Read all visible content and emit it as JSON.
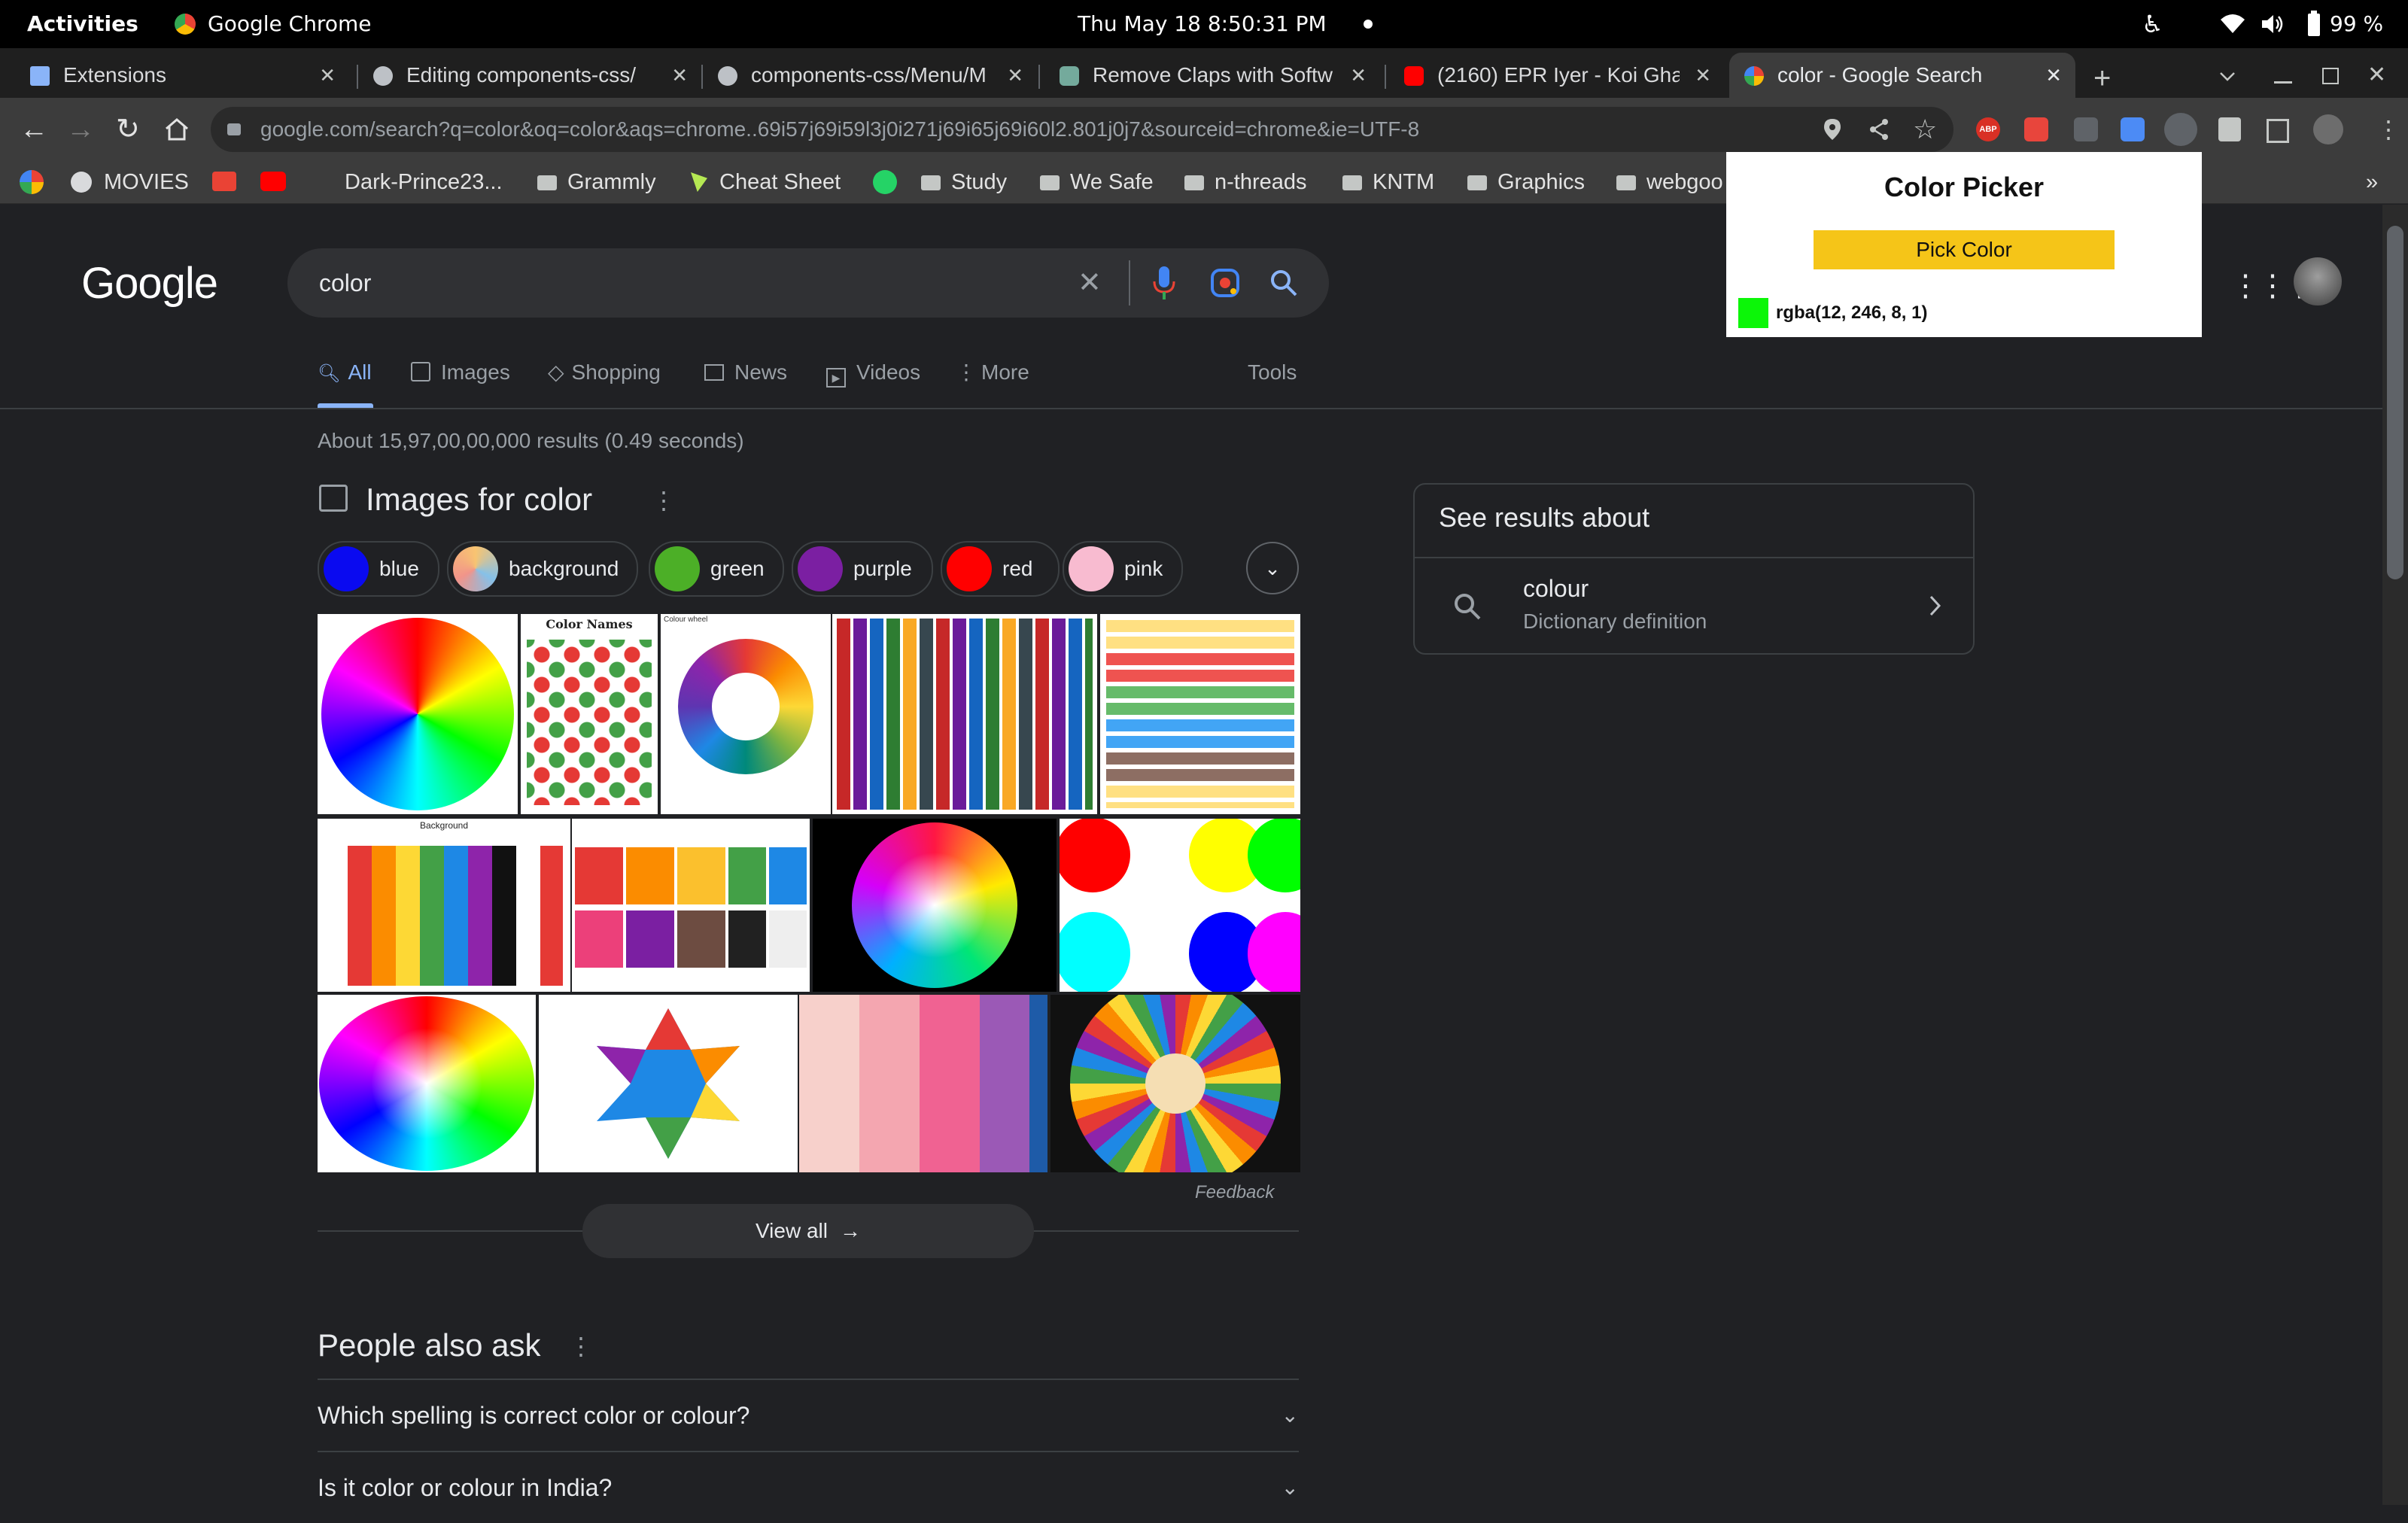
{
  "topbar": {
    "activities": "Activities",
    "app_name": "Google Chrome",
    "datetime": "Thu May 18   8:50:31 PM",
    "battery": "99 %"
  },
  "tabs": [
    {
      "label": "Extensions",
      "icon_color": "#8ab4f8"
    },
    {
      "label": "Editing components-css/",
      "icon_color": "#bdc1c6"
    },
    {
      "label": "components-css/Menu/M",
      "icon_color": "#bdc1c6"
    },
    {
      "label": "Remove Claps with Softw",
      "icon_color": "#74aa9c"
    },
    {
      "label": "(2160) EPR Iyer - Koi Gha",
      "icon_color": "#ff0000"
    },
    {
      "label": "color - Google Search",
      "icon_color": "#4285f4"
    }
  ],
  "address_bar": {
    "url": "google.com/search?q=color&oq=color&aqs=chrome..69i57j69i59l3j0i271j69i65j69i60l2.801j0j7&sourceid=chrome&ie=UTF-8"
  },
  "bookmarks": [
    "MOVIES",
    "Dark-Prince23...",
    "Grammly",
    "Cheat Sheet",
    "Study",
    "We Safe",
    "n-threads",
    "KNTM",
    "Graphics",
    "webgoo"
  ],
  "bookmarks_more": "»",
  "google": {
    "logo": "Google",
    "query": "color",
    "nav": [
      "All",
      "Images",
      "Shopping",
      "News",
      "Videos",
      "More"
    ],
    "tools": "Tools",
    "result_stats": "About 15,97,00,00,000 results (0.49 seconds)",
    "images_heading": "Images for color",
    "chips": [
      {
        "label": "blue",
        "color": "#0a0af0"
      },
      {
        "label": "background",
        "color": "#f0c080"
      },
      {
        "label": "green",
        "color": "#4caf27"
      },
      {
        "label": "purple",
        "color": "#7b1fa2"
      },
      {
        "label": "red",
        "color": "#ff0000"
      },
      {
        "label": "pink",
        "color": "#f8bbd0"
      }
    ],
    "thumb_texts": {
      "color_names": "Color Names",
      "colour_wheel": "Colour wheel",
      "background": "Background"
    },
    "feedback": "Feedback",
    "view_all": "View all",
    "people_also_ask": "People also ask",
    "questions": [
      "Which spelling is correct color or colour?",
      "Is it color or colour in India?"
    ],
    "side_panel": {
      "title": "See results about",
      "item": "colour",
      "item_sub": "Dictionary definition"
    }
  },
  "color_picker": {
    "title": "Color Picker",
    "button": "Pick Color",
    "value": "rgba(12, 246, 8, 1)",
    "swatch": "#0cf608",
    "button_color": "#f5c518"
  }
}
